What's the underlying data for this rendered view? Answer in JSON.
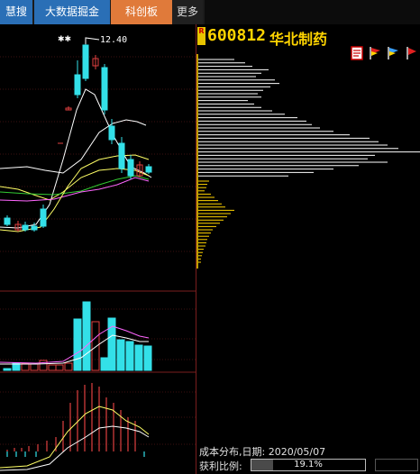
{
  "tabs": [
    {
      "label": "慧搜"
    },
    {
      "label": "大数据掘金"
    },
    {
      "label": "科创板"
    },
    {
      "label": "更多"
    }
  ],
  "chart": {
    "high_price_label": "12.40",
    "star_marks": "✱✱"
  },
  "stock": {
    "badge": "R",
    "code": "600812",
    "name": "华北制药"
  },
  "toolbar": {
    "icons": [
      "document-icon",
      "red-flag-icon",
      "blue-flag-icon",
      "cursor-flag-icon"
    ]
  },
  "cost_distribution": {
    "date_label": "成本分布,日期:",
    "date": "2020/05/07",
    "profit_label": "获利比例:",
    "profit_ratio_text": "19.1%",
    "profit_ratio": 0.191
  },
  "colors": {
    "up": "#33e0e8",
    "down": "#e04040",
    "ma5": "#ffffff",
    "ma10": "#ffff66",
    "ma20": "#ff66ff",
    "ma60": "#33cc33",
    "grid": "#7a1e1e",
    "profit": "#ffffff",
    "loss": "#ffd400"
  }
}
